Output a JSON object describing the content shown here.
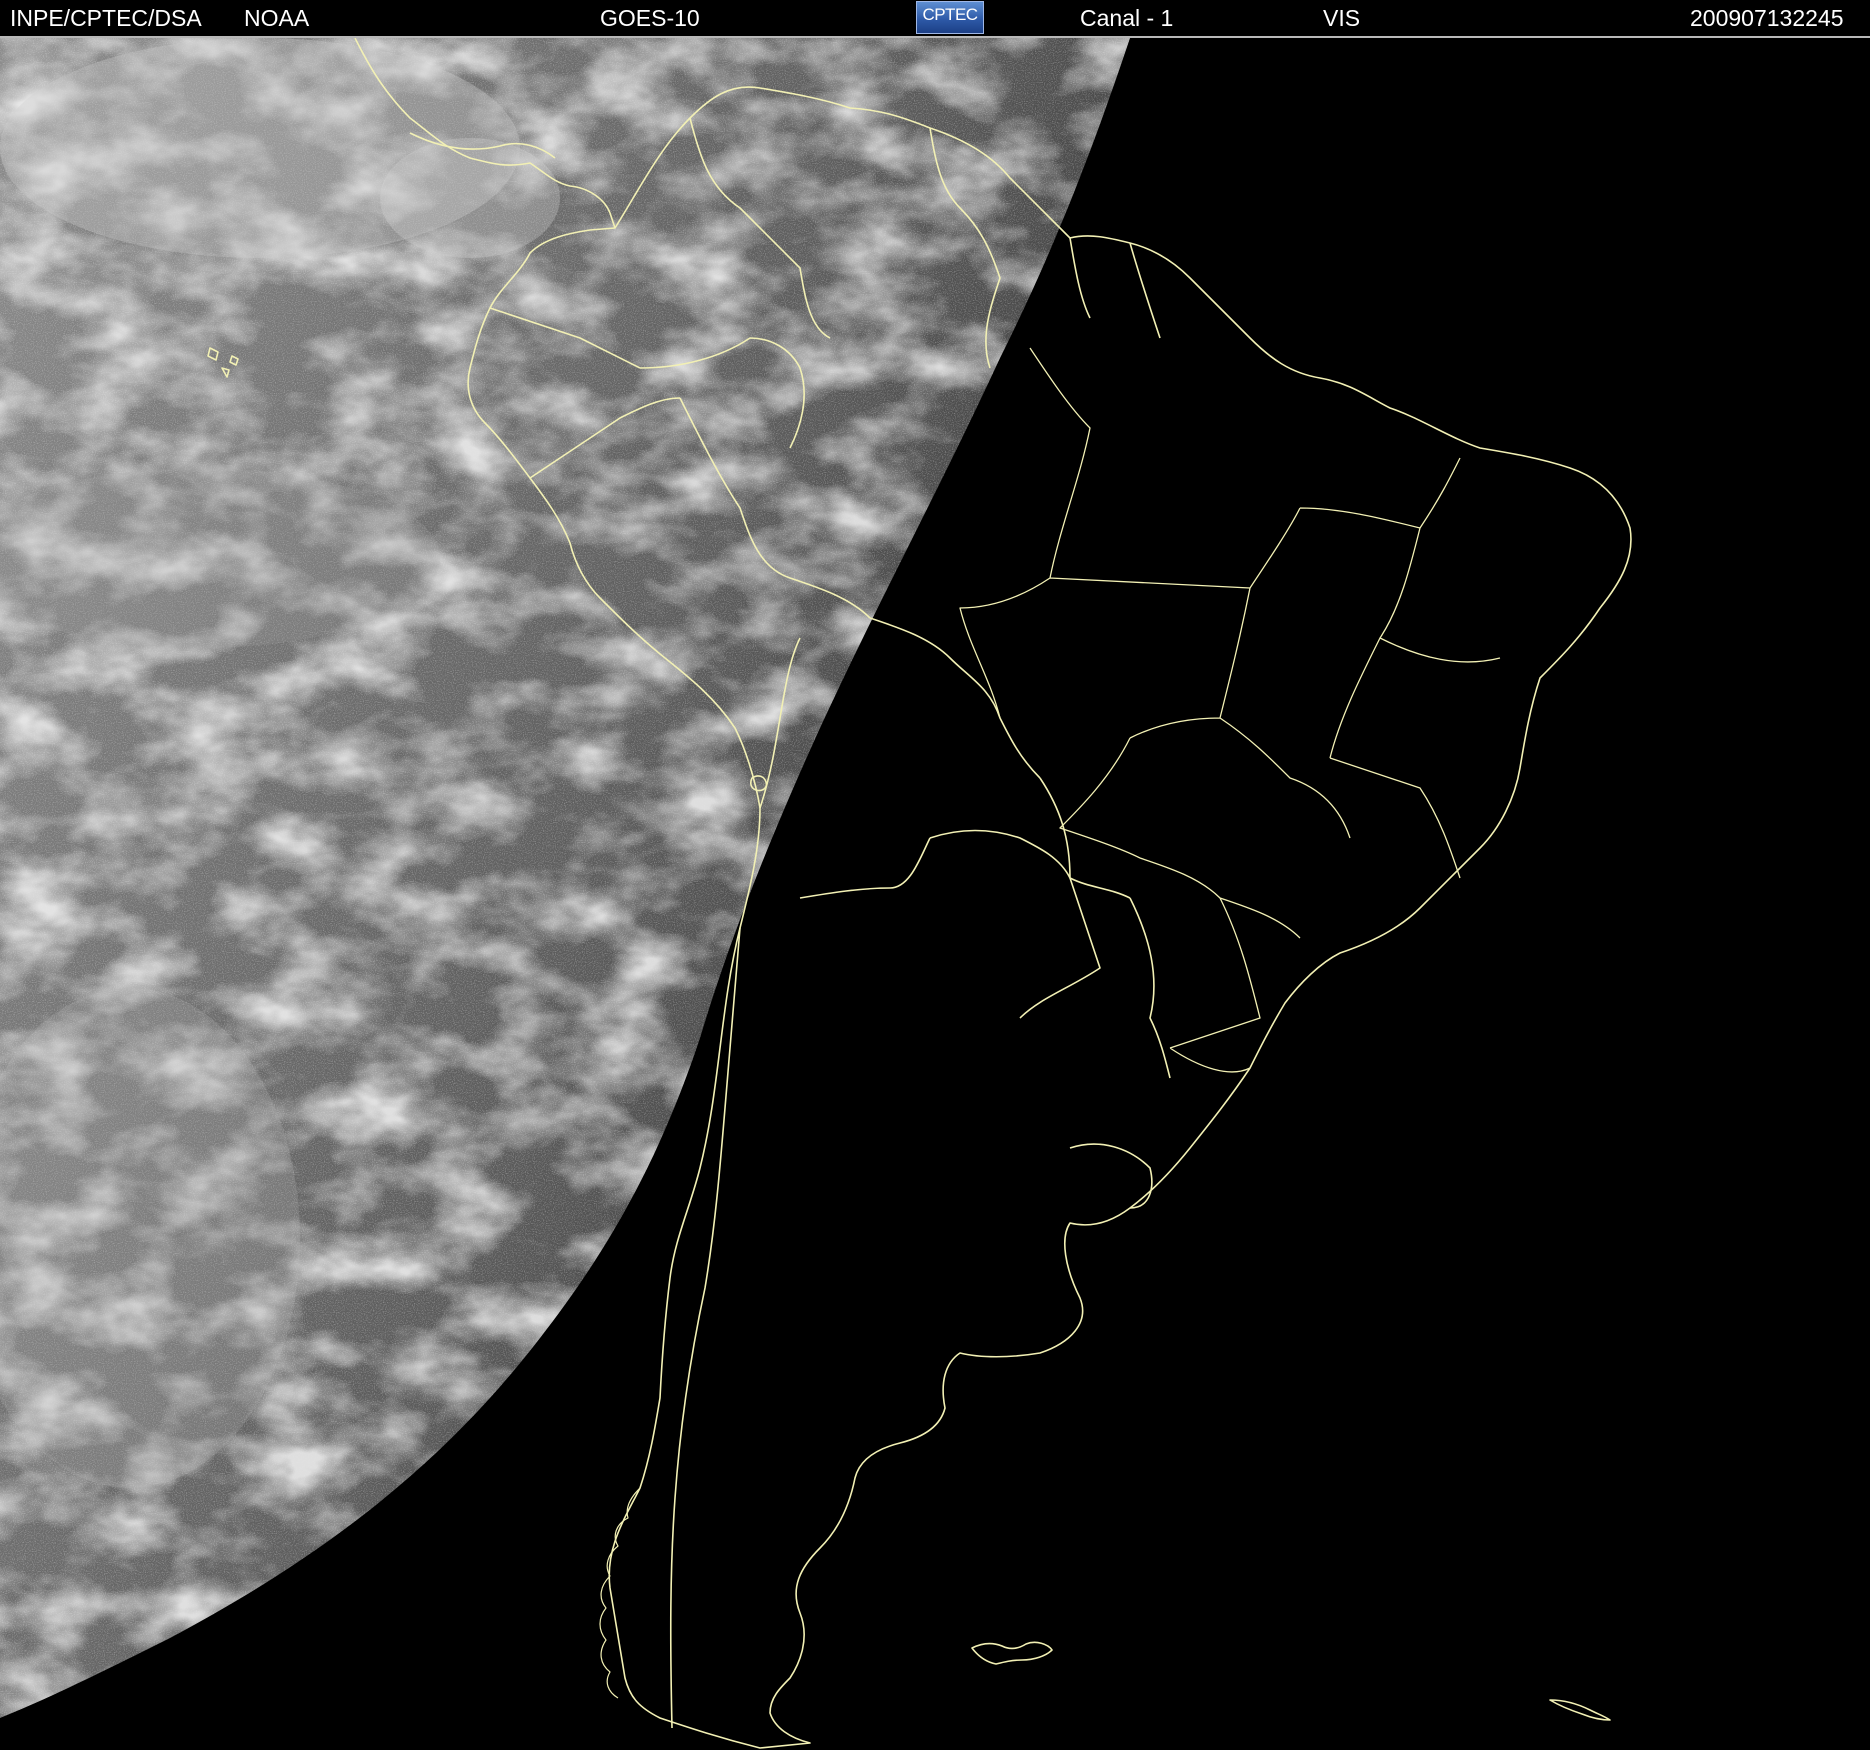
{
  "header": {
    "agency": "INPE/CPTEC/DSA",
    "provider": "NOAA",
    "satellite": "GOES-10",
    "logo_text": "CPTEC",
    "channel": "Canal - 1",
    "band": "VIS",
    "timestamp": "200907132245"
  },
  "colors": {
    "header_bg": "#000000",
    "header_text": "#ffffff",
    "border_lines": "#f2f0b4",
    "earth_day_cloud": "#9a9a9a",
    "night_side": "#000000"
  },
  "imagery": {
    "type": "visible-channel satellite image",
    "region": "South America",
    "terminator": "day side west, night side east"
  }
}
